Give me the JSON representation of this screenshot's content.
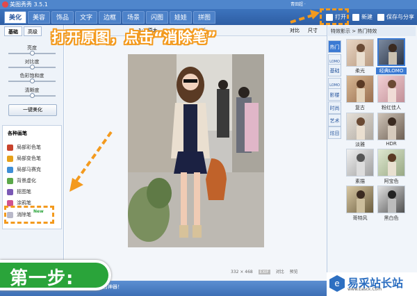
{
  "app": {
    "title": "美图秀秀 3.5.1",
    "user": "青田超 ·"
  },
  "main_tabs": [
    {
      "label": "美化",
      "active": true
    },
    {
      "label": "美容"
    },
    {
      "label": "饰品"
    },
    {
      "label": "文字"
    },
    {
      "label": "边框"
    },
    {
      "label": "场景"
    },
    {
      "label": "闪图"
    },
    {
      "label": "娃娃"
    },
    {
      "label": "拼图"
    }
  ],
  "toolbar_right": {
    "open": "打开",
    "new": "新建",
    "save_share": "保存与分享"
  },
  "left_panel": {
    "sub_tabs": [
      "基础",
      "高级"
    ],
    "sliders": [
      {
        "label": "亮度",
        "value": 0.5
      },
      {
        "label": "对比度",
        "value": 0.5
      },
      {
        "label": "色彩饱和度",
        "value": 0.5
      },
      {
        "label": "清晰度",
        "value": 0.5
      }
    ],
    "one_click_beautify": "一键美化",
    "tools_title": "各种画笔",
    "tools": [
      {
        "label": "局部彩色笔",
        "icon": "color-brush-icon",
        "color": "#c8432c"
      },
      {
        "label": "局部变色笔",
        "icon": "recolor-brush-icon",
        "color": "#e6a11a"
      },
      {
        "label": "局部马赛克",
        "icon": "mosaic-icon",
        "color": "#3e8ed6"
      },
      {
        "label": "背景虚化",
        "icon": "blur-icon",
        "color": "#5ba84a"
      },
      {
        "label": "抠图笔",
        "icon": "cutout-icon",
        "color": "#7a59b5"
      },
      {
        "label": "涂鸦笔",
        "icon": "doodle-icon",
        "color": "#d05390"
      },
      {
        "label": "消除笔",
        "icon": "eraser-icon",
        "color": "#b9b9c9",
        "badge": "New"
      }
    ]
  },
  "canvas": {
    "subtoolbar_left": "1:1 原大",
    "subtoolbar_mid": "新",
    "subtoolbar_right1": "对比",
    "subtoolbar_right2": "尺寸",
    "dimensions": "332 × 468",
    "compare": "对比",
    "preview": "预览",
    "exif": "EXIF"
  },
  "status": {
    "message": "百神器！"
  },
  "overlays": {
    "instruction": "打开原图，点击“消除笔”",
    "step": "第一步:",
    "accent_color": "#f39a1e",
    "step_color": "#2aa43a"
  },
  "right_panel": {
    "header": "特效影示 > 热门特效",
    "categories": [
      {
        "label": "热门",
        "active": true
      },
      {
        "label": "LOMO"
      },
      {
        "label": "基础"
      },
      {
        "label": "影楼"
      },
      {
        "label": "时尚"
      },
      {
        "label": "艺术"
      },
      {
        "label": "炫目"
      }
    ],
    "effects": [
      {
        "label": "柔光"
      },
      {
        "label": "经典LOMO",
        "selected": true
      },
      {
        "label": "复古"
      },
      {
        "label": "粉红佳人"
      },
      {
        "label": "淡雅"
      },
      {
        "label": "HDR"
      },
      {
        "label": "素描"
      },
      {
        "label": "阿宝色"
      },
      {
        "label": "哥特风"
      },
      {
        "label": "黑白色"
      }
    ]
  },
  "watermark": {
    "name": "易采站长站",
    "url": "www.Easck.Com"
  }
}
